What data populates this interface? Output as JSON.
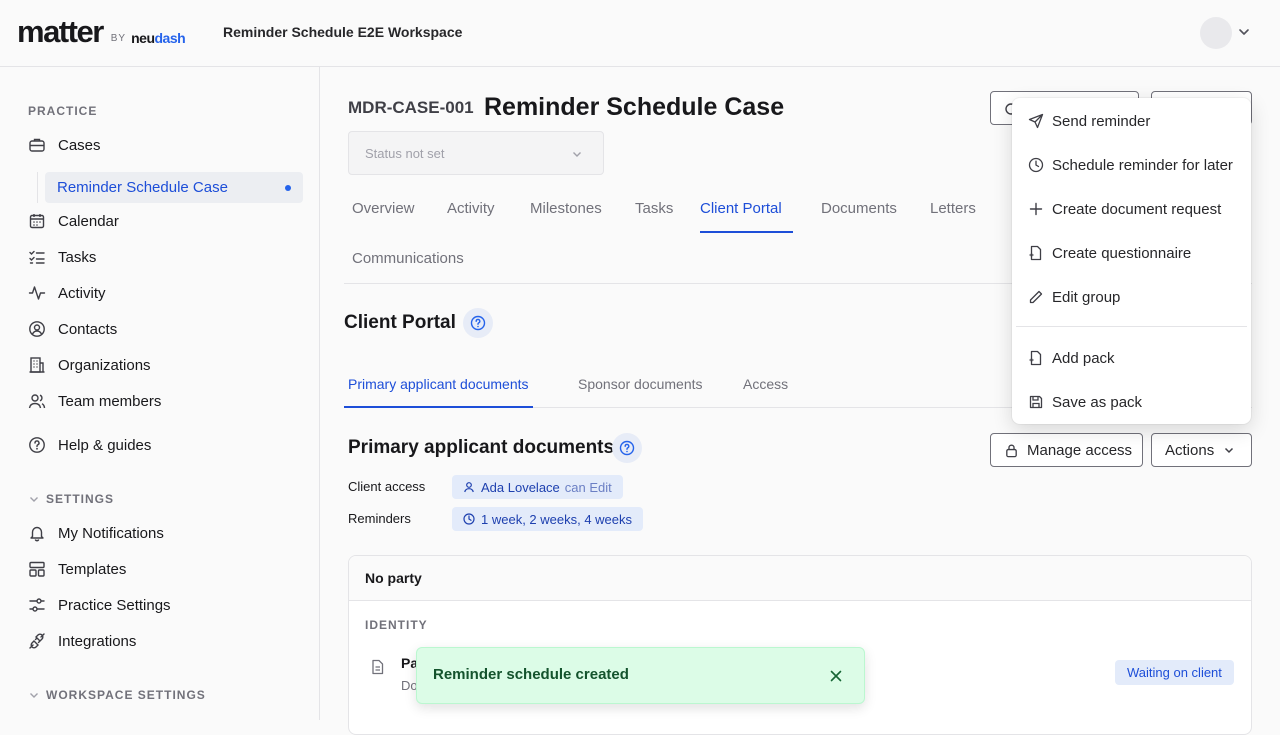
{
  "header": {
    "logo_main": "matter",
    "logo_by": "BY",
    "logo_neu": "neu",
    "logo_dash": "dash",
    "workspace_name": "Reminder Schedule E2E Workspace"
  },
  "sidebar": {
    "practice_label": "PRACTICE",
    "cases": "Cases",
    "active_case": "Reminder Schedule Case",
    "calendar": "Calendar",
    "tasks": "Tasks",
    "activity": "Activity",
    "contacts": "Contacts",
    "organizations": "Organizations",
    "team_members": "Team members",
    "help": "Help & guides",
    "settings_label": "SETTINGS",
    "my_notifications": "My Notifications",
    "templates": "Templates",
    "practice_settings": "Practice Settings",
    "integrations": "Integrations",
    "workspace_settings_label": "WORKSPACE SETTINGS"
  },
  "case": {
    "id": "MDR-CASE-001",
    "title": "Reminder Schedule Case",
    "status_placeholder": "Status not set"
  },
  "tabs": {
    "overview": "Overview",
    "activity": "Activity",
    "milestones": "Milestones",
    "tasks": "Tasks",
    "client_portal": "Client Portal",
    "documents": "Documents",
    "letters": "Letters",
    "communications": "Communications"
  },
  "client_portal": {
    "title": "Client Portal",
    "subtabs": {
      "primary": "Primary applicant documents",
      "sponsor": "Sponsor documents",
      "access": "Access"
    },
    "section_title": "Primary applicant documents",
    "manage_access": "Manage access",
    "actions": "Actions",
    "client_access_label": "Client access",
    "client_name": "Ada Lovelace",
    "client_perm": "can Edit",
    "reminders_label": "Reminders",
    "reminders_value": "1 week, 2 weeks, 4 weeks"
  },
  "card": {
    "header": "No party",
    "section": "IDENTITY",
    "doc_name": "Pa",
    "doc_sub": "Do",
    "status": "Waiting on client"
  },
  "toast": {
    "message": "Reminder schedule created"
  },
  "menu": {
    "send_reminder": "Send reminder",
    "schedule_later": "Schedule reminder for later",
    "create_doc_request": "Create document request",
    "create_questionnaire": "Create questionnaire",
    "edit_group": "Edit group",
    "add_pack": "Add pack",
    "save_as_pack": "Save as pack"
  },
  "colors": {
    "accent": "#1d4ed8",
    "toast_bg": "#dcfce7",
    "chip_bg": "#e3ebfa"
  }
}
